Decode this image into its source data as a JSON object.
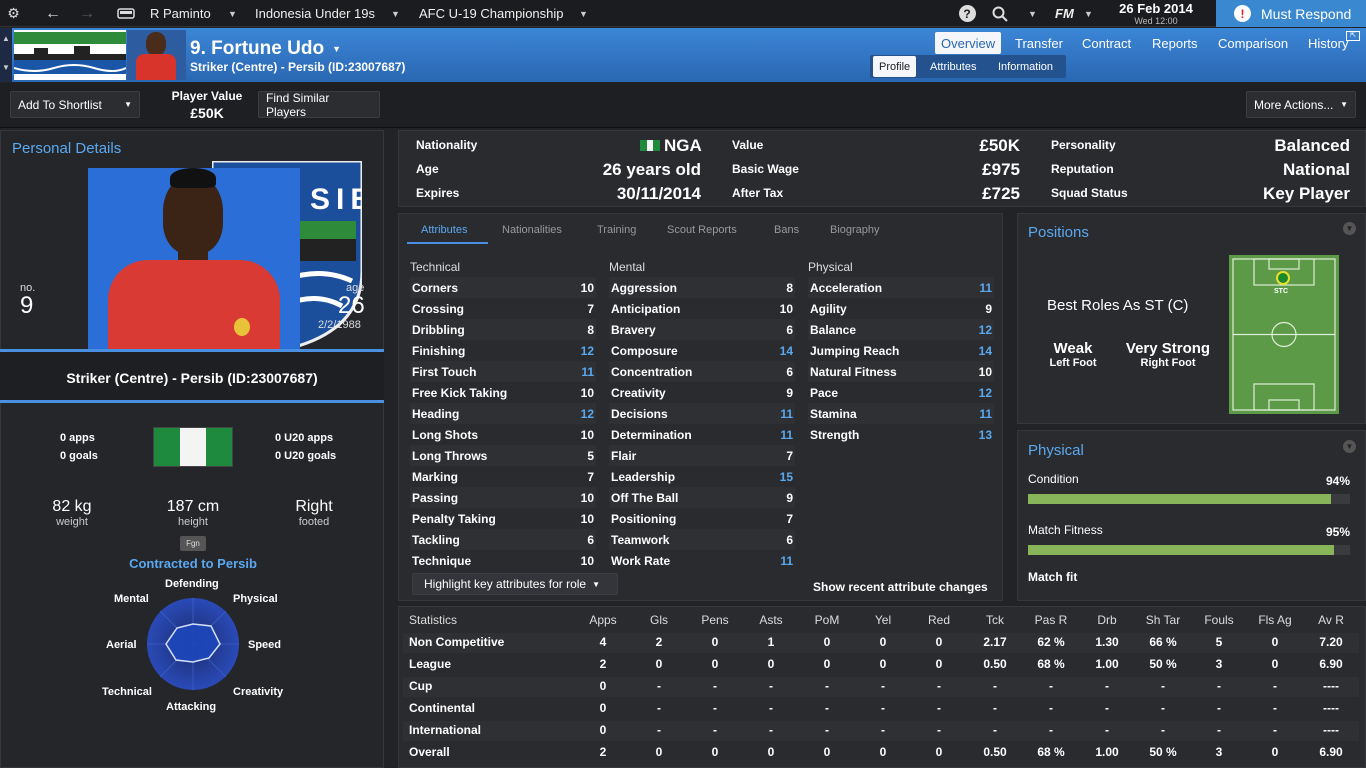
{
  "topbar": {
    "manager": "R Paminto",
    "team": "Indonesia Under 19s",
    "competition": "AFC U-19 Championship",
    "logo": "FM",
    "date": "26 Feb 2014",
    "time": "Wed 12:00",
    "respond": "Must Respond"
  },
  "header": {
    "player_name": "9. Fortune Udo",
    "subtitle": "Striker (Centre) - Persib (ID:23007687)",
    "tabs": [
      "Overview",
      "Transfer",
      "Contract",
      "Reports",
      "Comparison",
      "History"
    ],
    "subtabs": [
      "Profile",
      "Attributes",
      "Information"
    ]
  },
  "actions": {
    "shortlist": "Add To Shortlist",
    "value_label": "Player Value",
    "value": "£50K",
    "similar": "Find Similar Players",
    "more": "More Actions..."
  },
  "personal": {
    "title": "Personal Details",
    "no_label": "no.",
    "no": "9",
    "age_label": "age",
    "age": "26",
    "dob": "2/2/1988",
    "role": "Striker (Centre) - Persib (ID:23007687)",
    "apps": "0 apps",
    "goals": "0 goals",
    "u20apps": "0 U20 apps",
    "u20goals": "0 U20 goals",
    "weight": "82 kg",
    "weight_label": "weight",
    "height": "187 cm",
    "height_label": "height",
    "foot": "Right",
    "foot_label": "footed",
    "fgn": "Fgn",
    "contract": "Contracted to Persib",
    "radar": [
      "Defending",
      "Physical",
      "Speed",
      "Creativity",
      "Attacking",
      "Technical",
      "Aerial",
      "Mental"
    ]
  },
  "info": {
    "nationality_label": "Nationality",
    "nationality": "NGA",
    "age_label": "Age",
    "age": "26 years old",
    "expires_label": "Expires",
    "expires": "30/11/2014",
    "value_label": "Value",
    "value": "£50K",
    "wage_label": "Basic Wage",
    "wage": "£975",
    "tax_label": "After Tax",
    "tax": "£725",
    "personality_label": "Personality",
    "personality": "Balanced",
    "reputation_label": "Reputation",
    "reputation": "National",
    "squad_label": "Squad Status",
    "squad": "Key Player"
  },
  "attr_tabs": [
    "Attributes",
    "Nationalities",
    "Training",
    "Scout Reports",
    "Bans",
    "Biography"
  ],
  "attributes": {
    "technical_title": "Technical",
    "mental_title": "Mental",
    "physical_title": "Physical",
    "technical": [
      {
        "name": "Corners",
        "v": "10"
      },
      {
        "name": "Crossing",
        "v": "7"
      },
      {
        "name": "Dribbling",
        "v": "8"
      },
      {
        "name": "Finishing",
        "v": "12"
      },
      {
        "name": "First Touch",
        "v": "11"
      },
      {
        "name": "Free Kick Taking",
        "v": "10"
      },
      {
        "name": "Heading",
        "v": "12"
      },
      {
        "name": "Long Shots",
        "v": "10"
      },
      {
        "name": "Long Throws",
        "v": "5"
      },
      {
        "name": "Marking",
        "v": "7"
      },
      {
        "name": "Passing",
        "v": "10"
      },
      {
        "name": "Penalty Taking",
        "v": "10"
      },
      {
        "name": "Tackling",
        "v": "6"
      },
      {
        "name": "Technique",
        "v": "10"
      }
    ],
    "mental": [
      {
        "name": "Aggression",
        "v": "8"
      },
      {
        "name": "Anticipation",
        "v": "10"
      },
      {
        "name": "Bravery",
        "v": "6"
      },
      {
        "name": "Composure",
        "v": "14"
      },
      {
        "name": "Concentration",
        "v": "6"
      },
      {
        "name": "Creativity",
        "v": "9"
      },
      {
        "name": "Decisions",
        "v": "11"
      },
      {
        "name": "Determination",
        "v": "11"
      },
      {
        "name": "Flair",
        "v": "7"
      },
      {
        "name": "Leadership",
        "v": "15"
      },
      {
        "name": "Off The Ball",
        "v": "9"
      },
      {
        "name": "Positioning",
        "v": "7"
      },
      {
        "name": "Teamwork",
        "v": "6"
      },
      {
        "name": "Work Rate",
        "v": "11"
      }
    ],
    "physical": [
      {
        "name": "Acceleration",
        "v": "11"
      },
      {
        "name": "Agility",
        "v": "9"
      },
      {
        "name": "Balance",
        "v": "12"
      },
      {
        "name": "Jumping Reach",
        "v": "14"
      },
      {
        "name": "Natural Fitness",
        "v": "10"
      },
      {
        "name": "Pace",
        "v": "12"
      },
      {
        "name": "Stamina",
        "v": "11"
      },
      {
        "name": "Strength",
        "v": "13"
      }
    ],
    "highlight": "Highlight key attributes for role",
    "recent": "Show recent attribute changes"
  },
  "positions": {
    "title": "Positions",
    "best": "Best Roles As ST (C)",
    "weak": "Weak",
    "weak_label": "Left Foot",
    "strong": "Very Strong",
    "strong_label": "Right Foot",
    "pitch_label": "STC"
  },
  "physical": {
    "title": "Physical",
    "condition_label": "Condition",
    "condition": "94%",
    "condition_level": 0.94,
    "fitness_label": "Match Fitness",
    "fitness": "95%",
    "fitness_level": 0.95,
    "matchfit": "Match fit"
  },
  "stats": {
    "headers": [
      "Statistics",
      "Apps",
      "Gls",
      "Pens",
      "Asts",
      "PoM",
      "Yel",
      "Red",
      "Tck",
      "Pas R",
      "Drb",
      "Sh Tar",
      "Fouls",
      "Fls Ag",
      "Av R"
    ],
    "rows": [
      [
        "Non Competitive",
        "4",
        "2",
        "0",
        "1",
        "0",
        "0",
        "0",
        "2.17",
        "62 %",
        "1.30",
        "66 %",
        "5",
        "0",
        "7.20"
      ],
      [
        "League",
        "2",
        "0",
        "0",
        "0",
        "0",
        "0",
        "0",
        "0.50",
        "68 %",
        "1.00",
        "50 %",
        "3",
        "0",
        "6.90"
      ],
      [
        "Cup",
        "0",
        "-",
        "-",
        "-",
        "-",
        "-",
        "-",
        "-",
        "-",
        "-",
        "-",
        "-",
        "-",
        "----"
      ],
      [
        "Continental",
        "0",
        "-",
        "-",
        "-",
        "-",
        "-",
        "-",
        "-",
        "-",
        "-",
        "-",
        "-",
        "-",
        "----"
      ],
      [
        "International",
        "0",
        "-",
        "-",
        "-",
        "-",
        "-",
        "-",
        "-",
        "-",
        "-",
        "-",
        "-",
        "-",
        "----"
      ],
      [
        "Overall",
        "2",
        "0",
        "0",
        "0",
        "0",
        "0",
        "0",
        "0.50",
        "68 %",
        "1.00",
        "50 %",
        "3",
        "0",
        "6.90"
      ]
    ]
  },
  "colors": {
    "accent": "#5aa9f0",
    "header": "#3b86d6",
    "bar": "#88b45a",
    "respond": "#3a88d0"
  }
}
